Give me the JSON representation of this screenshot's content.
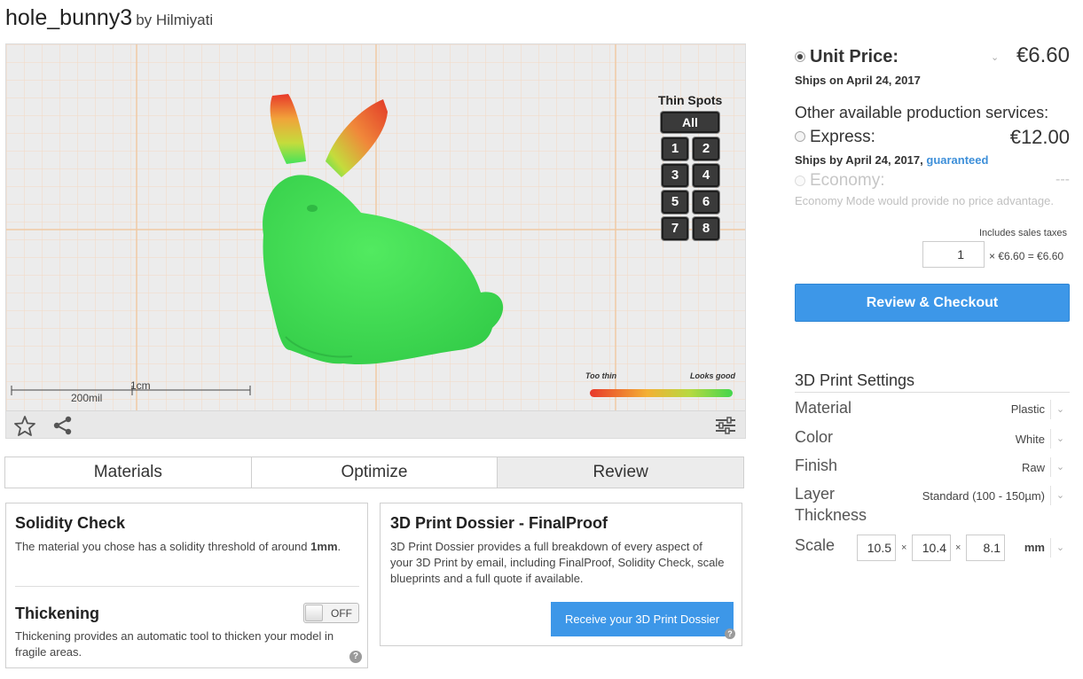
{
  "model": {
    "name": "hole_bunny3",
    "by_label": "by Hilmiyati"
  },
  "viewer": {
    "thin_spots": {
      "title": "Thin Spots",
      "all_label": "All",
      "buttons": [
        "1",
        "2",
        "3",
        "4",
        "5",
        "6",
        "7",
        "8"
      ]
    },
    "legend": {
      "left": "Too thin",
      "right": "Looks good"
    },
    "scale": {
      "metric": "1cm",
      "imperial": "200mil"
    }
  },
  "tabs": [
    "Materials",
    "Optimize",
    "Review"
  ],
  "active_tab": "Review",
  "solidity": {
    "title": "Solidity Check",
    "text": "The material you chose has a solidity threshold of around",
    "threshold": "1mm",
    "period": "."
  },
  "thickening": {
    "title": "Thickening",
    "toggle": "OFF",
    "text": "Thickening provides an automatic tool to thicken your model in fragile areas."
  },
  "dossier": {
    "title": "3D Print Dossier - FinalProof",
    "text": "3D Print Dossier provides a full breakdown of every aspect of your 3D Print by email, including FinalProof, Solidity Check, scale blueprints and a full quote if available.",
    "button": "Receive your 3D Print Dossier"
  },
  "pricing": {
    "unit_label": "Unit Price:",
    "unit_price": "€6.60",
    "unit_ships": "Ships on April 24, 2017",
    "other_label": "Other available production services:",
    "express_label": "Express:",
    "express_price": "€12.00",
    "express_ships": "Ships by April 24, 2017,",
    "express_guarantee": "guaranteed",
    "economy_label": "Economy:",
    "economy_price": "---",
    "economy_note": "Economy Mode would provide no price advantage.",
    "tax_note": "Includes sales taxes",
    "quantity": "1",
    "total": "× €6.60 = €6.60",
    "checkout": "Review & Checkout"
  },
  "settings": {
    "title": "3D Print Settings",
    "material_label": "Material",
    "material_value": "Plastic",
    "color_label": "Color",
    "color_value": "White",
    "finish_label": "Finish",
    "finish_value": "Raw",
    "layer_label_1": "Layer",
    "layer_label_2": "Thickness",
    "layer_value": "Standard (100 - 150µm)",
    "scale_label": "Scale",
    "scale_x": "10.5",
    "scale_y": "10.4",
    "scale_z": "8.1",
    "scale_unit": "mm",
    "times": "×"
  },
  "colors": {
    "accent": "#3d97e8",
    "link": "#3d8fd9",
    "mesh_good": "#45e35a",
    "mesh_thin": "#e8382a"
  }
}
